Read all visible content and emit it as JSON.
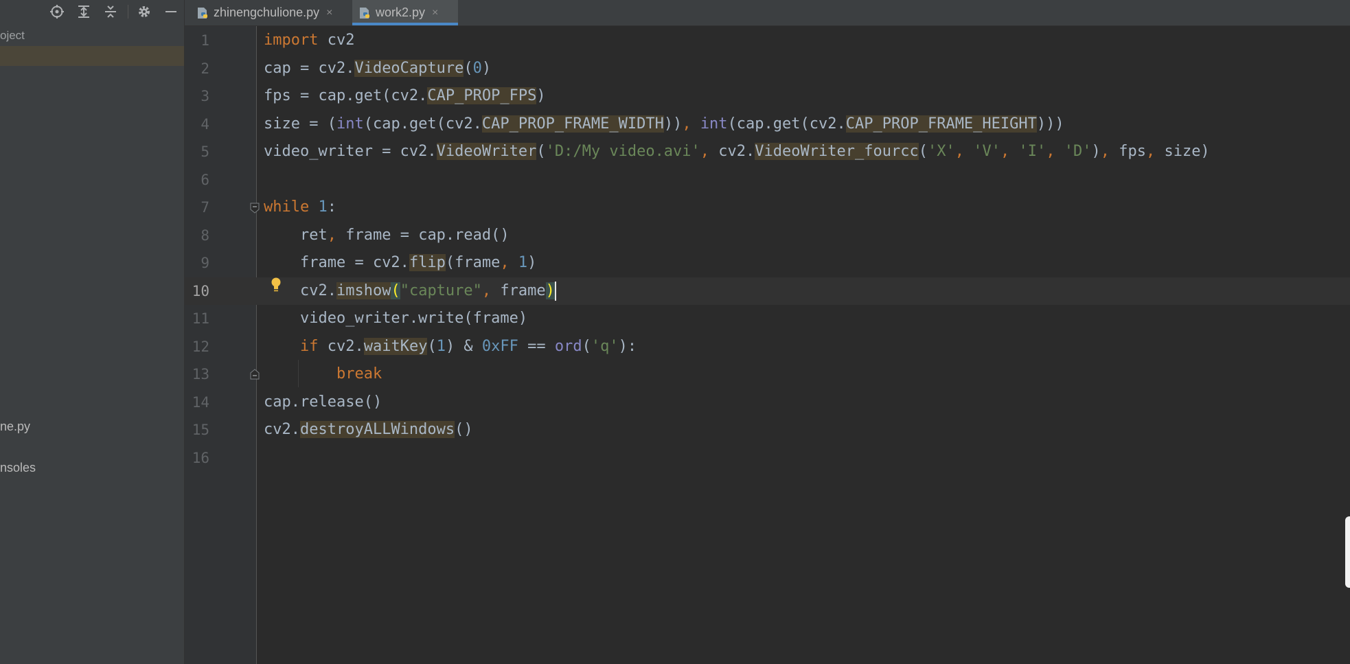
{
  "sidebar": {
    "project_label": "oject",
    "item_file": "ne.py",
    "item_consoles": "nsoles"
  },
  "tabs": [
    {
      "label": "zhinengchulione.py",
      "close": "×",
      "active": false
    },
    {
      "label": "work2.py",
      "close": "×",
      "active": true
    }
  ],
  "editor": {
    "line_numbers": [
      "1",
      "2",
      "3",
      "4",
      "5",
      "6",
      "7",
      "8",
      "9",
      "10",
      "11",
      "12",
      "13",
      "14",
      "15",
      "16"
    ],
    "current_line": 10
  },
  "colors": {
    "keyword": "#cc7832",
    "number": "#6897bb",
    "string": "#6a8759",
    "builtin": "#8888c6",
    "default": "#a9b7c6",
    "accent": "#4a88c7"
  },
  "tokens": {
    "l1": [
      "import",
      "cv2"
    ],
    "l2": [
      "cap = cv2.",
      "VideoCapture",
      "(",
      "0",
      ")"
    ],
    "l3": [
      "fps = cap.get(cv2.",
      "CAP_PROP_FPS",
      ")"
    ],
    "l4": [
      "size = (",
      "int",
      "(cap.get(cv2.",
      "CAP_PROP_FRAME_WIDTH",
      "))",
      ", ",
      "int",
      "(cap.get(cv2.",
      "CAP_PROP_FRAME_HEIGHT",
      ")))"
    ],
    "l5": [
      "video_writer = cv2.",
      "VideoWriter",
      "(",
      "'D:/My video.avi'",
      ", ",
      "cv2.",
      "VideoWriter_fourcc",
      "(",
      "'X'",
      ", ",
      "'V'",
      ", ",
      "'I'",
      ", ",
      "'D'",
      ")",
      ", ",
      "fps",
      ", ",
      "size)"
    ],
    "l7": [
      "while",
      " ",
      "1",
      ":"
    ],
    "l8": [
      "ret",
      ", ",
      "frame = cap.read()"
    ],
    "l9": [
      "frame = cv2.",
      "flip",
      "(frame",
      ", ",
      "1",
      ")"
    ],
    "l10": [
      "cv2.",
      "imshow",
      "(",
      "\"capture\"",
      ", ",
      "frame",
      ")"
    ],
    "l11": [
      "video_writer.write(frame)"
    ],
    "l12": [
      "if",
      " cv2.",
      "waitKey",
      "(",
      "1",
      ") & ",
      "0xFF",
      " == ",
      "ord",
      "(",
      "'q'",
      "):"
    ],
    "l13": [
      "break"
    ],
    "l14": [
      "cap.release()"
    ],
    "l15": [
      "cv2.",
      "destroyALLWindows",
      "()"
    ]
  }
}
